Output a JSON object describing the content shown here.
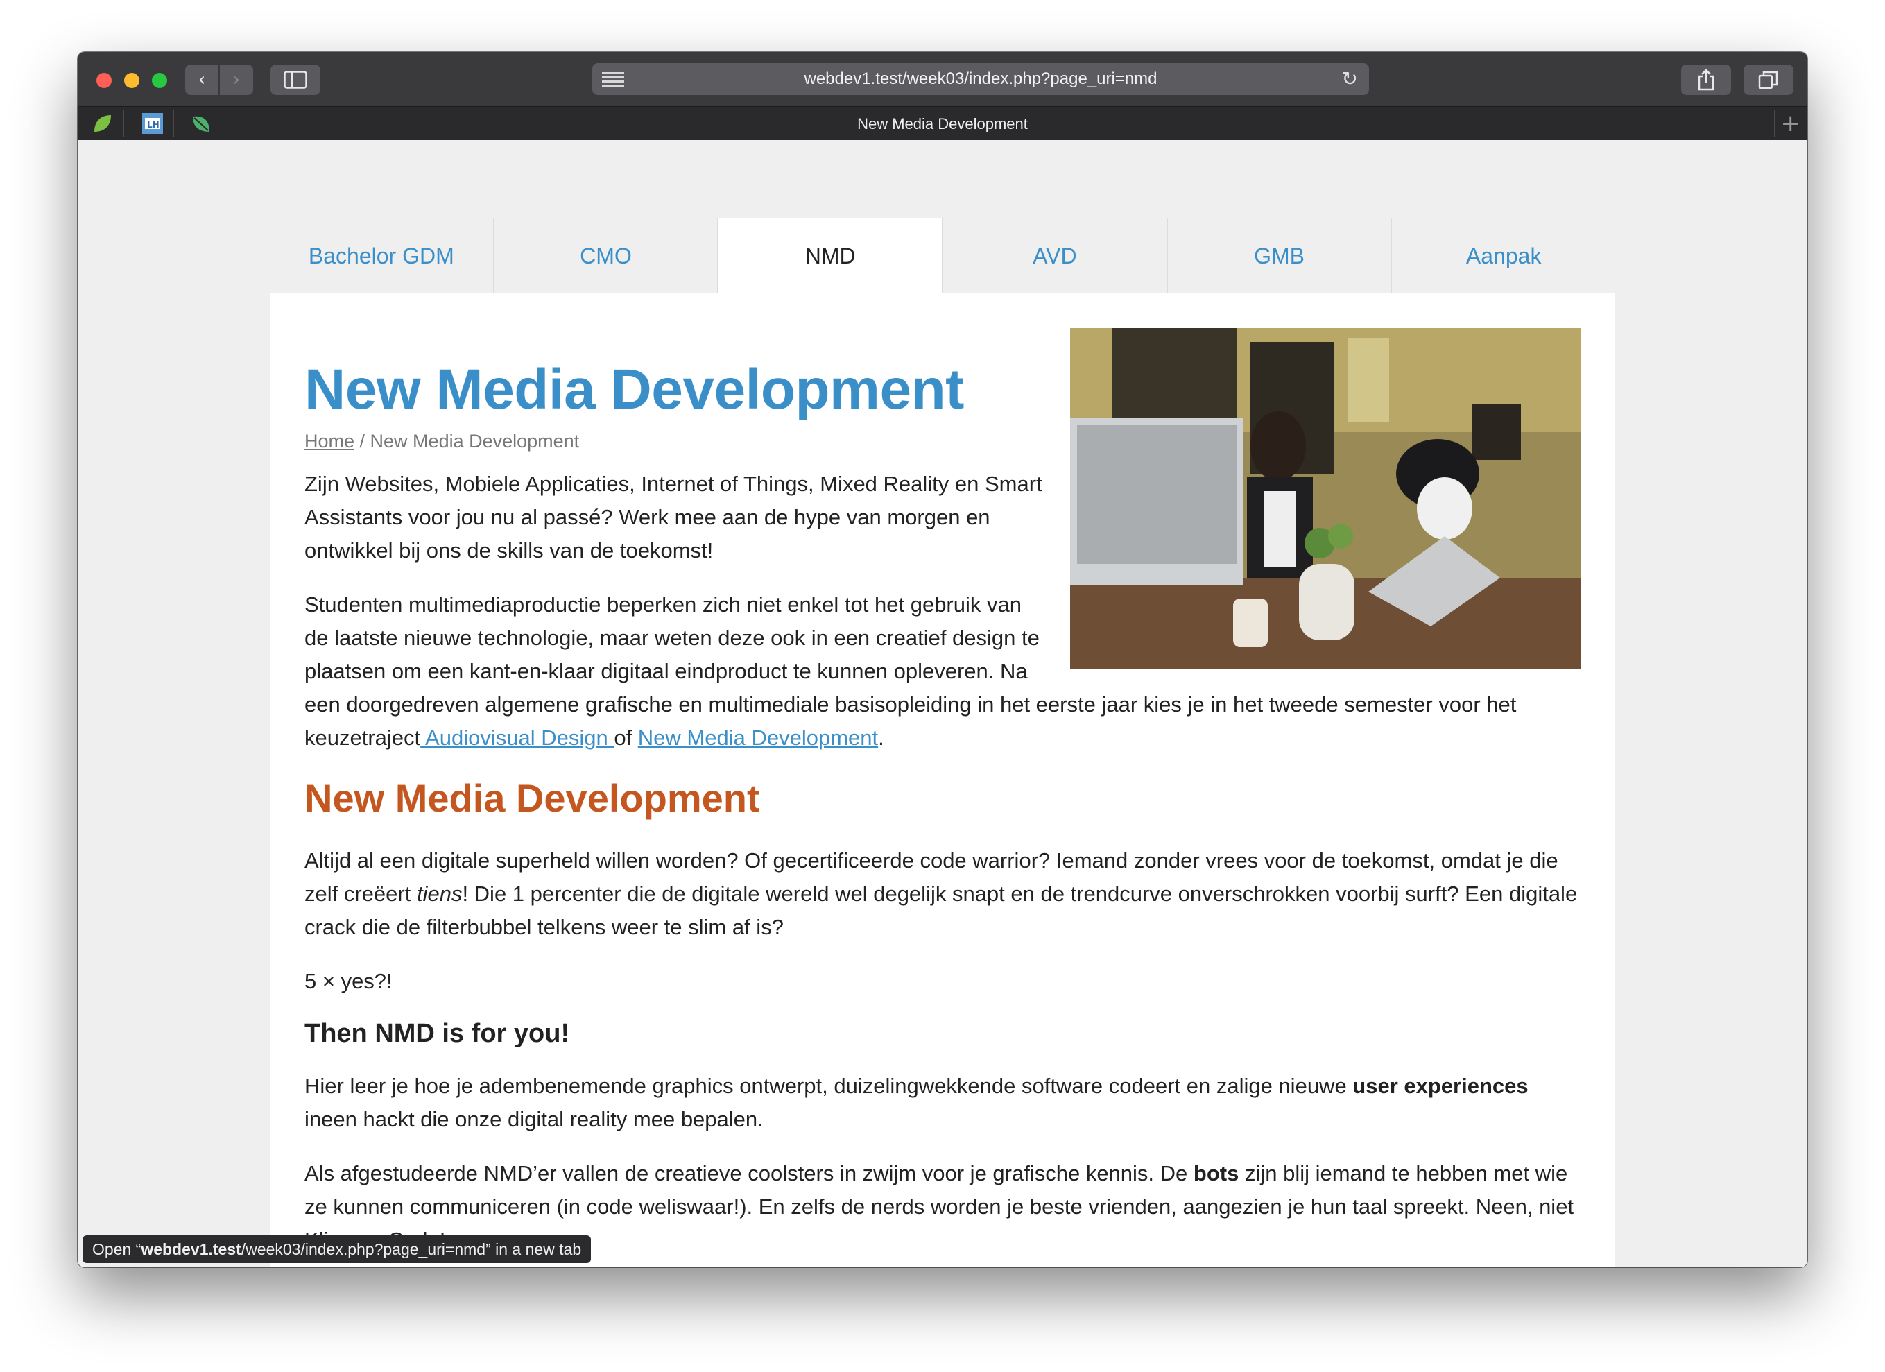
{
  "browser": {
    "url": "webdev1.test/week03/index.php?page_uri=nmd",
    "tab_title": "New Media Development",
    "back_glyph": "‹",
    "forward_glyph": "›",
    "newtab_glyph": "+",
    "reload_glyph": "↻",
    "status_prefix": "Open “",
    "status_host": "webdev1.test",
    "status_path": "/week03/index.php?page_uri=nmd",
    "status_suffix": "” in a new tab",
    "icons": [
      "reader-icon",
      "reload-icon",
      "sidebar-icon",
      "share-icon",
      "tabs-icon",
      "leaf-icon",
      "lh-icon",
      "leaf-icon"
    ]
  },
  "nav": {
    "tabs": [
      {
        "label": "Bachelor GDM"
      },
      {
        "label": "CMO"
      },
      {
        "label": "NMD"
      },
      {
        "label": "AVD"
      },
      {
        "label": "GMB"
      },
      {
        "label": "Aanpak"
      }
    ],
    "active": "NMD"
  },
  "page": {
    "title": "New Media Development",
    "breadcrumb_home": "Home",
    "breadcrumb_sep": " / ",
    "breadcrumb_current": "New Media Development",
    "intro": "Zijn Websites, Mobiele Applicaties, Internet of Things, Mixed Reality en Smart Assistants voor jou nu al passé? Werk mee aan de hype van morgen en ontwikkel bij ons de skills van de toekomst!",
    "p2_text": "Studenten multimediaproductie beperken zich niet enkel tot het gebruik van de laatste nieuwe technologie, maar weten deze ook in een creatief design te plaatsen om een kant-en-klaar digitaal eindproduct te kunnen opleveren. Na een doorgedreven algemene grafische en multimediale basisopleiding in het eerste jaar kies je in het tweede semester voor het keuzetraject",
    "p2_link1": " Audiovisual Design ",
    "p2_of": "of ",
    "p2_link2": "New Media Development",
    "p2_end": ".",
    "section_title": "New Media Development",
    "s1_a": "Altijd al een digitale superheld willen worden? Of gecertificeerde code warrior? Iemand zonder vrees voor de toekomst, omdat je die zelf creëert ",
    "s1_em": "tiens",
    "s1_b": "! Die 1 percenter die de digitale wereld wel degelijk snapt en de trendcurve onverschrokken voorbij surft? Een digitale crack die de filterbubbel telkens weer te slim af is?",
    "s2": "5 × yes?!",
    "subheading": "Then NMD is for you!",
    "s3_a": "Hier leer je hoe je adembenemende graphics ontwerpt, duizelingwekkende software codeert en zalige nieuwe ",
    "s3_strong": "user experiences",
    "s3_b": " ineen hackt die onze digital reality mee bepalen.",
    "s4_a": "Als afgestudeerde NMD’er vallen de creatieve coolsters in zwijm voor je grafische kennis. De ",
    "s4_strong": "bots",
    "s4_b": " zijn blij iemand te hebben met wie ze kunnen communiceren (in code weliswaar!). En zelfs de nerds worden je beste vrienden, aangezien je hun taal spreekt. Neen, niet Klingon. Code!"
  },
  "colors": {
    "accent_blue": "#3b8fc9",
    "section_orange": "#c4571f"
  }
}
